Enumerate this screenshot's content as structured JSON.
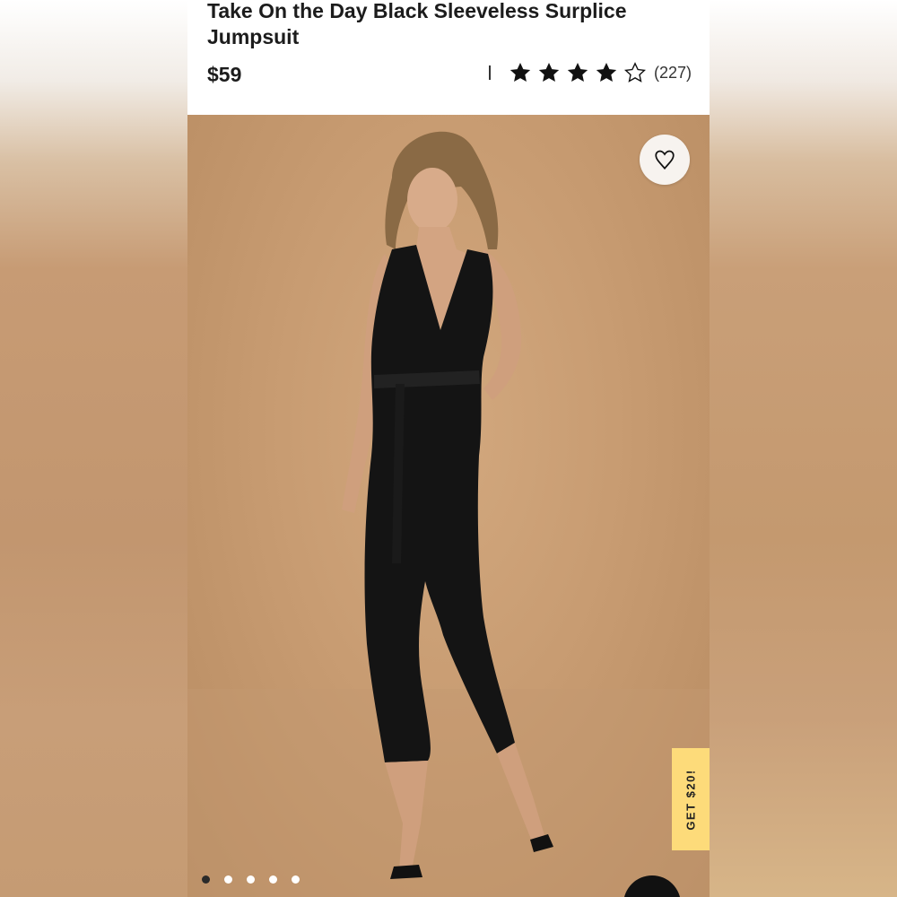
{
  "product": {
    "title": "Take On the Day Black Sleeveless Surplice Jumpsuit",
    "price": "$59",
    "rating": 4,
    "rating_max": 5,
    "review_count": "(227)"
  },
  "gallery": {
    "image_count": 5,
    "active_index": 0,
    "alt": "Model wearing black sleeveless surplice jumpsuit"
  },
  "promo": {
    "label": "GET $20!",
    "color": "#fddb7a"
  },
  "icons": {
    "favorite": "heart-icon",
    "rating_full": "star-filled-icon",
    "rating_empty": "star-outline-icon",
    "chat": "chat-icon"
  }
}
